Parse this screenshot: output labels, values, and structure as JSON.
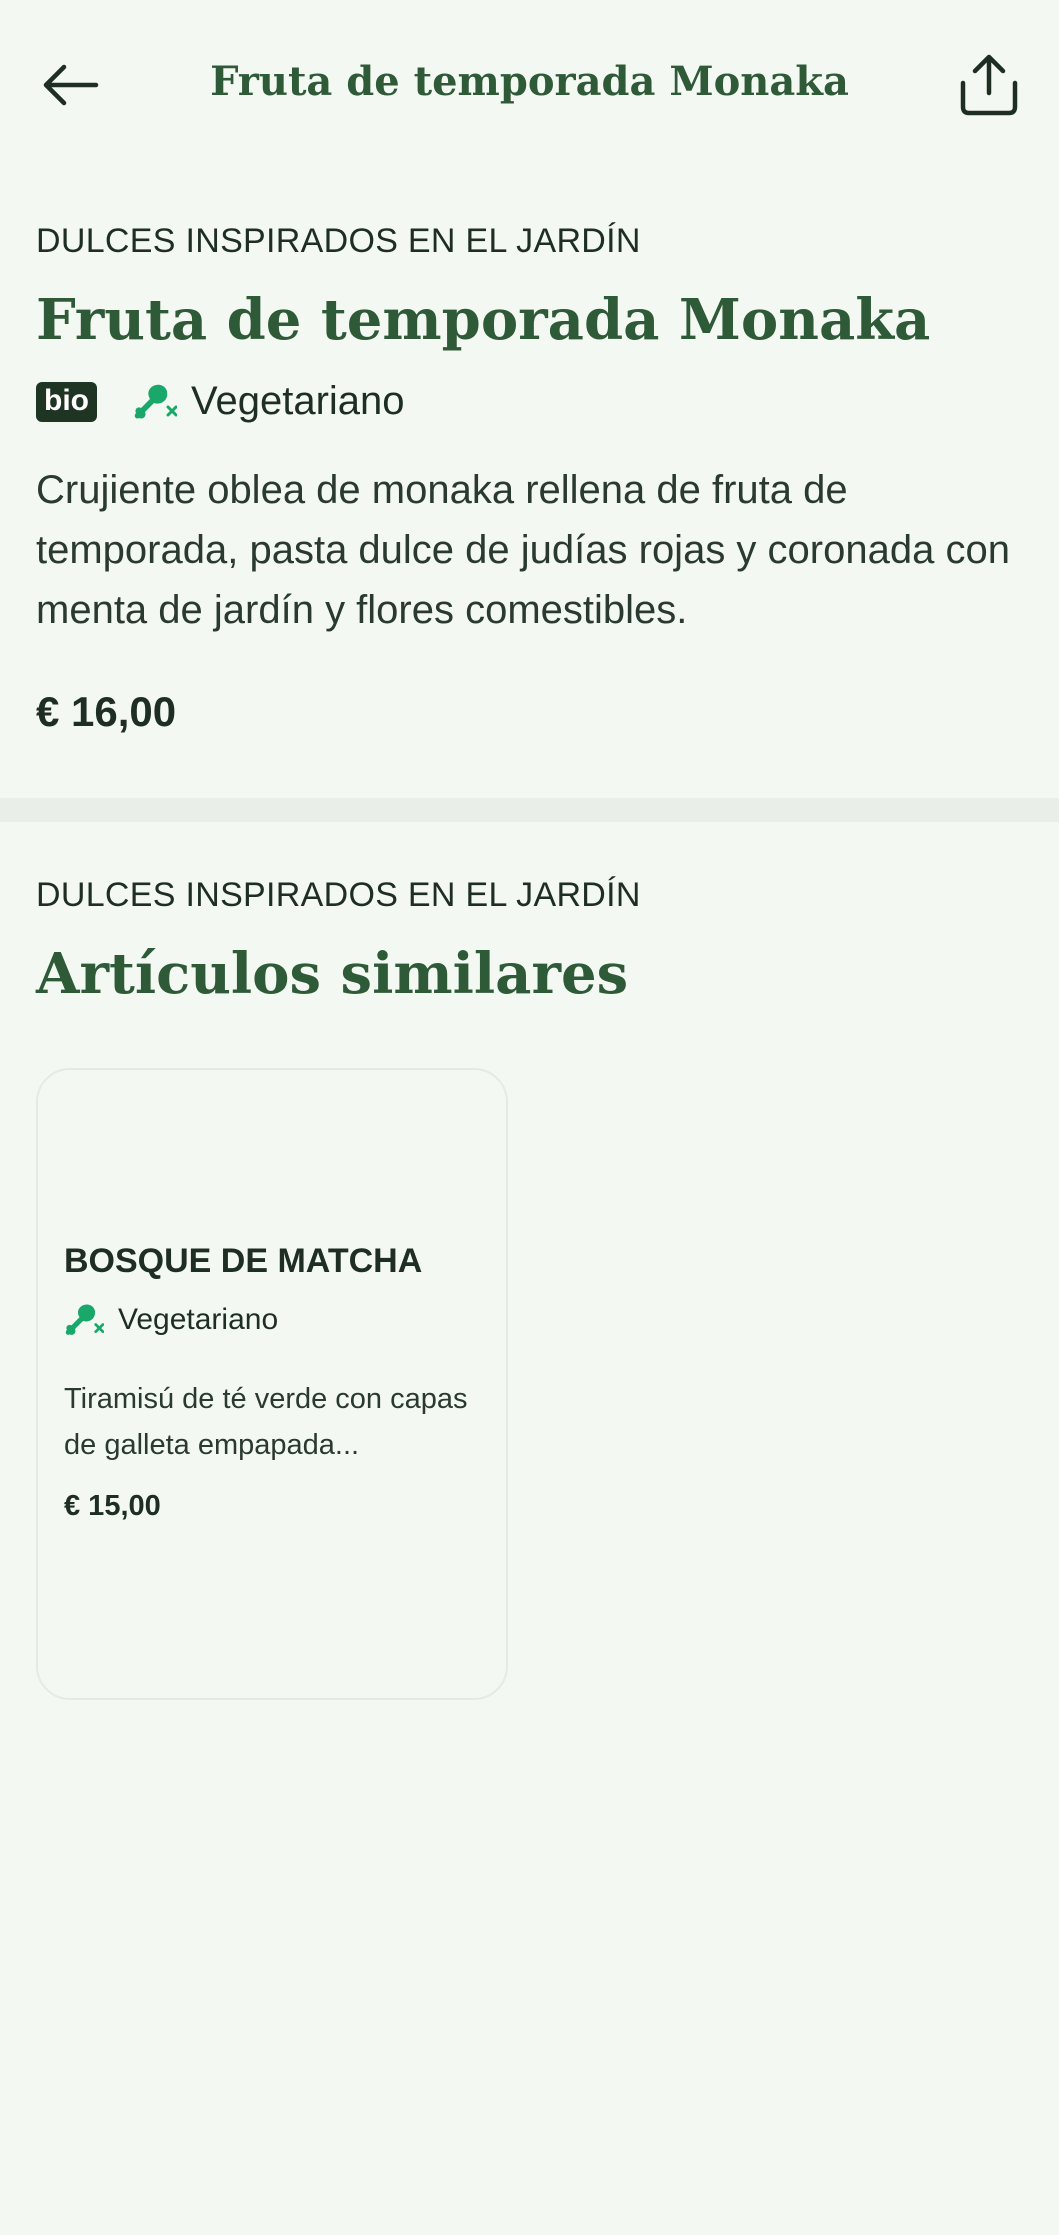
{
  "header": {
    "title": "Fruta de temporada Monaka"
  },
  "product": {
    "category": "DULCES INSPIRADOS EN EL JARDÍN",
    "name": "Fruta de temporada Monaka",
    "badge": "bio",
    "diet_label": "Vegetariano",
    "description": "Crujiente oblea de monaka rellena de fruta de temporada, pasta dulce de judías rojas y coronada con menta de jardín y flores comestibles.",
    "price": "€ 16,00"
  },
  "similar": {
    "category": "DULCES INSPIRADOS EN EL JARDÍN",
    "heading": "Artículos similares",
    "items": [
      {
        "name": "BOSQUE DE MATCHA",
        "diet_label": "Vegetariano",
        "description": "Tiramisú de té verde con capas de galleta empapada...",
        "price": "€ 15,00"
      }
    ]
  },
  "icons": {
    "back": "arrow-left-icon",
    "share": "share-icon",
    "diet": "drumstick-crossed-icon"
  },
  "colors": {
    "background": "#f4f8f3",
    "brand_green": "#2f5a38",
    "diet_green": "#1aa86a",
    "badge_dark": "#1e3523"
  }
}
